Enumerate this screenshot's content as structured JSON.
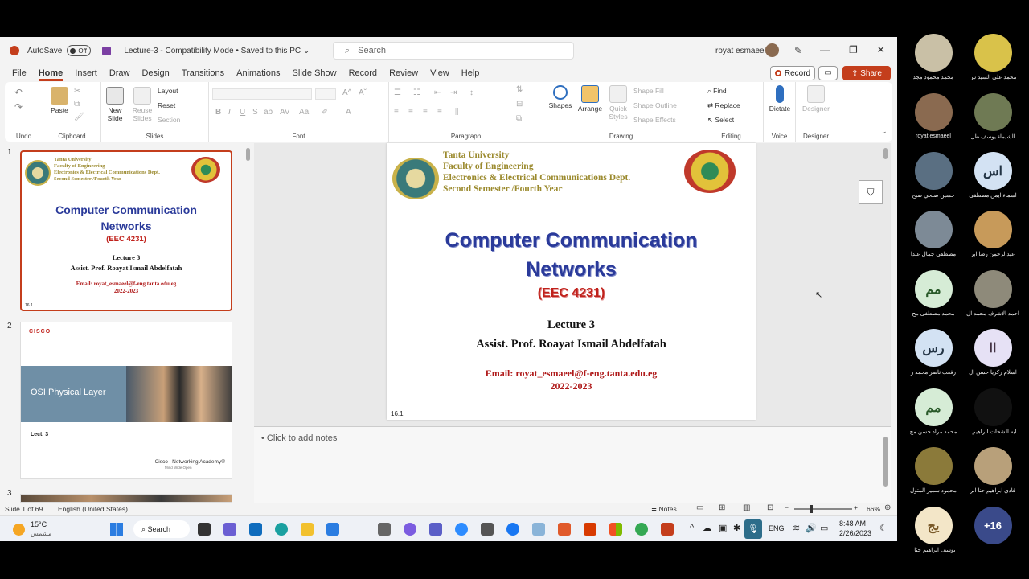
{
  "titlebar": {
    "autosave_label": "AutoSave",
    "autosave_state": "Off",
    "doc_title": "Lecture-3  -  Compatibility Mode  •  Saved to this PC ⌄",
    "search_placeholder": "Search",
    "user_name": "royat esmaeel"
  },
  "menu": [
    "File",
    "Home",
    "Insert",
    "Draw",
    "Design",
    "Transitions",
    "Animations",
    "Slide Show",
    "Record",
    "Review",
    "View",
    "Help"
  ],
  "menu_active": "Home",
  "actions": {
    "record": "Record",
    "share": "Share"
  },
  "ribbon": {
    "groups": [
      "Undo",
      "Clipboard",
      "Slides",
      "Font",
      "Paragraph",
      "Drawing",
      "Editing",
      "Voice",
      "Designer"
    ],
    "clipboard": {
      "paste": "Paste"
    },
    "slides": {
      "new_slide": "New Slide",
      "reuse": "Reuse Slides",
      "layout": "Layout",
      "reset": "Reset",
      "section": "Section"
    },
    "drawing": {
      "shapes": "Shapes",
      "arrange": "Arrange",
      "quick_styles": "Quick Styles",
      "fill": "Shape Fill",
      "outline": "Shape Outline",
      "effects": "Shape Effects"
    },
    "editing": {
      "find": "Find",
      "replace": "Replace",
      "select": "Select"
    },
    "voice": {
      "dictate": "Dictate"
    },
    "designer": {
      "designer": "Designer"
    }
  },
  "slide1": {
    "university": "Tanta University",
    "faculty": "Faculty  of  Engineering",
    "dept": "Electronics & Electrical Communications Dept.",
    "semester": "Second Semester /Fourth Year",
    "title_line1": "Computer Communication",
    "title_line2": "Networks",
    "code": "(EEC 4231)",
    "lecture": "Lecture 3",
    "author": "Assist. Prof. Roayat Ismail Abdelfatah",
    "email": "Email: royat_esmaeel@f-eng.tanta.edu.eg",
    "year": "2022-2023",
    "slide_number": "16.1"
  },
  "thumb_slide1": {
    "num": "1",
    "university": "Tanta University",
    "faculty": "Faculty  of  Engineering",
    "dept": "Electronics & Electrical Communications Dept.",
    "semester": "Second Semester /Fourth Year",
    "title_line1": "Computer Communication",
    "title_line2": "Networks",
    "code": "(EEC 4231)",
    "lecture": "Lecture 3",
    "author": "Assist. Prof. Roayat Ismail Abdelfatah",
    "email": "Email: royat_esmaeel@f-eng.tanta.edu.eg",
    "year": "2022-2023",
    "slide_number": "16.1"
  },
  "thumb_slide2": {
    "num": "2",
    "cisco": "CISCO",
    "heading": "OSI Physical Layer",
    "lect": "Lect. 3",
    "academy": "Cisco | Networking Academy®",
    "tagline": "Mind Wide Open"
  },
  "thumb_slide3": {
    "num": "3"
  },
  "notes_placeholder": "Click to add notes",
  "status": {
    "slide_info": "Slide 1 of 69",
    "language": "English (United States)",
    "notes": "Notes",
    "zoom": "66%"
  },
  "taskbar": {
    "weather_temp": "15°C",
    "weather_desc": "مشمس",
    "search": "Search",
    "lang": "ENG",
    "time": "8:48 AM",
    "date": "2/26/2023"
  },
  "participants": [
    {
      "name": "محمد محمود مجد",
      "initials": "",
      "color": "#c9c0a6"
    },
    {
      "name": "محمد علي السيد س",
      "initials": "",
      "color": "#d9c24a"
    },
    {
      "name": "royat esmaeel",
      "initials": "",
      "color": "#8a6a50"
    },
    {
      "name": "الشيماء يوسف طل",
      "initials": "",
      "color": "#6f7a54"
    },
    {
      "name": "حسين صبحي صبح",
      "initials": "",
      "color": "#5a6f82"
    },
    {
      "name": "اسماء ايمن مصطفى",
      "initials": "اس",
      "color": "#d3e2f3"
    },
    {
      "name": "مصطفى جمال عبدا",
      "initials": "",
      "color": "#7d8a96"
    },
    {
      "name": "عبدالرحمن رضا ابر",
      "initials": "",
      "color": "#c79a5a"
    },
    {
      "name": "محمد مصطفى مح",
      "initials": "مم",
      "color": "#d6ecd6"
    },
    {
      "name": "احمد الاشرف محمد ال",
      "initials": "",
      "color": "#8e8a7a"
    },
    {
      "name": "رفعت ناصر محمد ر",
      "initials": "رس",
      "color": "#d3e2f3"
    },
    {
      "name": "اسلام زكريا حسن ال",
      "initials": "اا",
      "color": "#e6e1f5"
    },
    {
      "name": "محمد مراد حسن مح",
      "initials": "مم",
      "color": "#d6ecd6"
    },
    {
      "name": "ايه الشحات ابراهيم ا",
      "initials": "",
      "color": "#111111"
    },
    {
      "name": "محمود سمير المتول",
      "initials": "",
      "color": "#8b7a3a"
    },
    {
      "name": "فادي ابراهيم حنا ابر",
      "initials": "",
      "color": "#b8a07a"
    },
    {
      "name": "يوسف ابراهيم حنا ا",
      "initials": "يج",
      "color": "#f3e6c8"
    },
    {
      "name": "",
      "initials": "+16",
      "color": "#3a4a8a"
    }
  ],
  "colors": {
    "accent": "#c43e1c",
    "title_blue": "#2a3a9a",
    "code_red": "#c0211b",
    "header_gold": "#9b8a2e"
  }
}
